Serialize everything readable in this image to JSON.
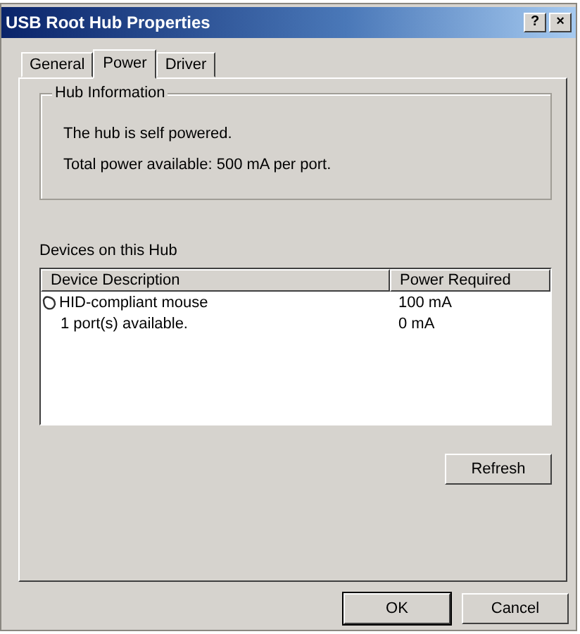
{
  "window": {
    "title": "USB Root Hub Properties",
    "help_button": "?",
    "close_button": "×"
  },
  "tabs": [
    {
      "label": "General",
      "selected": false
    },
    {
      "label": "Power",
      "selected": true
    },
    {
      "label": "Driver",
      "selected": false
    }
  ],
  "hub_information": {
    "title": "Hub Information",
    "lines": [
      "The hub is self powered.",
      "Total power available:  500 mA per port."
    ]
  },
  "devices": {
    "label": "Devices on this Hub",
    "columns": [
      "Device Description",
      "Power Required"
    ],
    "rows": [
      {
        "kind": "device",
        "description": "HID-compliant mouse",
        "power": "100 mA"
      },
      {
        "kind": "ports",
        "description": "1 port(s) available.",
        "power": "0 mA"
      }
    ]
  },
  "refresh_button": "Refresh",
  "buttons": [
    {
      "label": "OK",
      "selected": true
    },
    {
      "label": "Cancel",
      "selected": false
    }
  ]
}
